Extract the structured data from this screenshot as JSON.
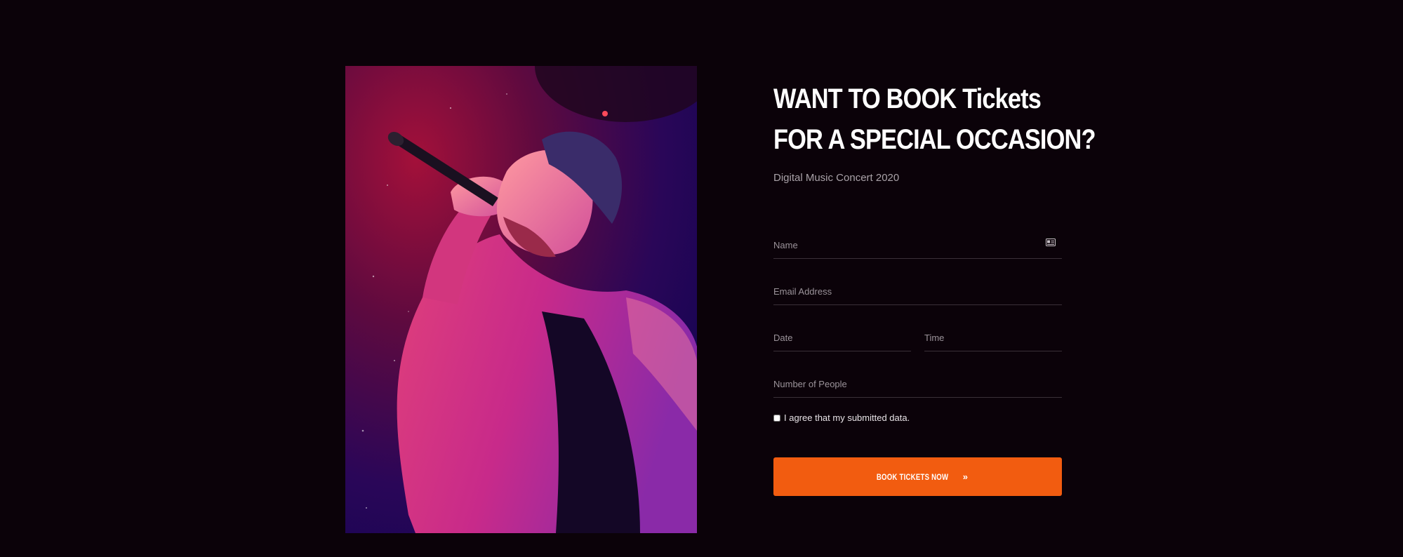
{
  "booking": {
    "heading_line1": "WANT TO BOOK Tickets",
    "heading_line2": "FOR A SPECIAL OCCASION?",
    "subtitle": "Digital Music Concert 2020",
    "form": {
      "name_placeholder": "Name",
      "email_placeholder": "Email Address",
      "date_placeholder": "Date",
      "time_placeholder": "Time",
      "people_placeholder": "Number of People",
      "agree_label": "I agree that my submitted data.",
      "agree_checked": false,
      "submit_label": "BOOK TICKETS NOW",
      "submit_icon": "double-chevron-right-icon",
      "name_icon": "id-card-icon"
    }
  },
  "colors": {
    "background": "#0b0209",
    "accent": "#f25c10",
    "heading": "#ffffff",
    "subtitle": "#a9a2a8"
  }
}
